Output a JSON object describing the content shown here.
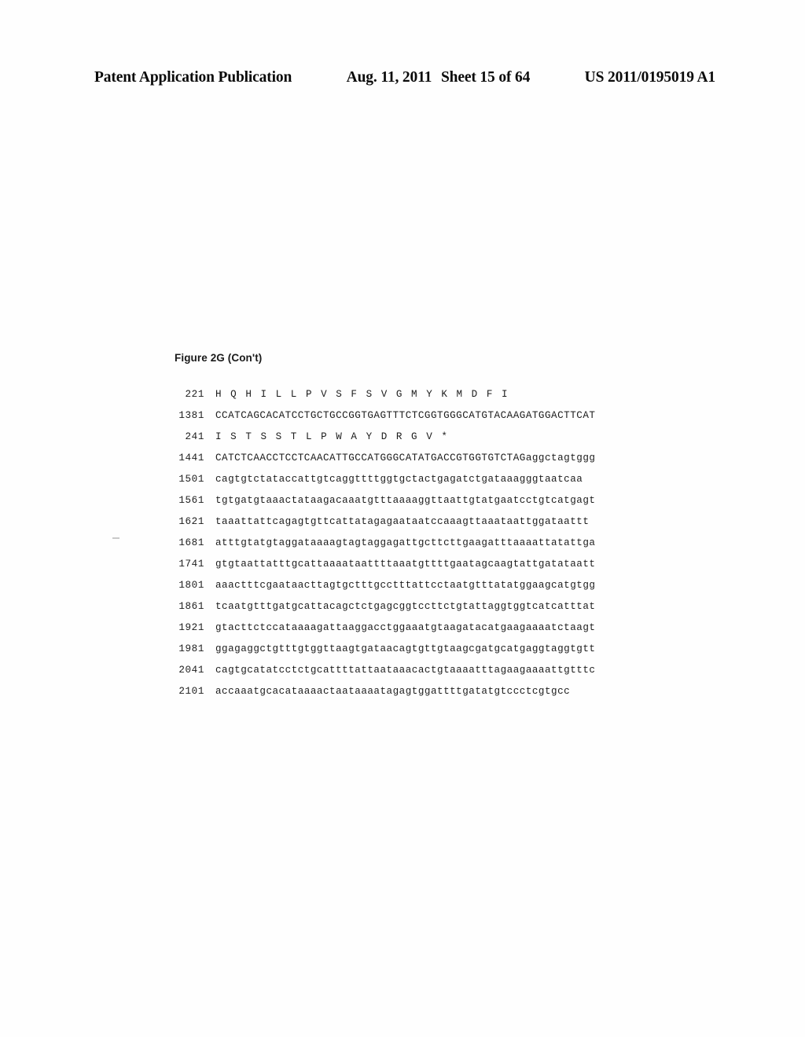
{
  "header": {
    "left": "Patent Application Publication",
    "date": "Aug. 11, 2011",
    "sheet": "Sheet 15 of 64",
    "right": "US 2011/0195019 A1"
  },
  "figure": {
    "caption": "Figure 2G (Con't)"
  },
  "sequence": {
    "rows": [
      {
        "index": "221",
        "kind": "protein",
        "text": "HQHILLPVSFSVGMYKMDFI"
      },
      {
        "index": "1381",
        "kind": "nucleotide",
        "text": "CCATCAGCACATCCTGCTGCCGGTGAGTTTCTCGGTGGGCATGTACAAGATGGACTTCAT"
      },
      {
        "index": "241",
        "kind": "protein",
        "text": "ISTSSTLPWAYDRGV*"
      },
      {
        "index": "1441",
        "kind": "nucleotide",
        "text": "CATCTCAACCTCCTCAACATTGCCATGGGCATATGACCGTGGTGTCTAGaggctagtggg"
      },
      {
        "index": "1501",
        "kind": "nucleotide",
        "text": "cagtgtctataccattgtcaggttttggtgctactgagatctgataaagggtaatcaa"
      },
      {
        "index": "1561",
        "kind": "nucleotide",
        "text": "tgtgatgtaaactataagacaaatgtttaaaaggttaattgtatgaatcctgtcatgagt"
      },
      {
        "index": "1621",
        "kind": "nucleotide",
        "text": "taaattattcagagtgttcattatagagaataatccaaagttaaataattggataattt"
      },
      {
        "index": "1681",
        "kind": "nucleotide",
        "text": "atttgtatgtaggataaaagtagtaggagattgcttcttgaagatttaaaattatattga"
      },
      {
        "index": "1741",
        "kind": "nucleotide",
        "text": "gtgtaattatttgcattaaaataattttaaatgttttgaatagcaagtattgatataatt"
      },
      {
        "index": "1801",
        "kind": "nucleotide",
        "text": "aaactttcgaataacttagtgctttgcctttattcctaatgtttatatggaagcatgtgg"
      },
      {
        "index": "1861",
        "kind": "nucleotide",
        "text": "tcaatgtttgatgcattacagctctgagcggtccttctgtattaggtggtcatcatttat"
      },
      {
        "index": "1921",
        "kind": "nucleotide",
        "text": "gtacttctccataaaagattaaggacctggaaatgtaagatacatgaagaaaatctaagt"
      },
      {
        "index": "1981",
        "kind": "nucleotide",
        "text": "ggagaggctgtttgtggttaagtgataacagtgttgtaagcgatgcatgaggtaggtgtt"
      },
      {
        "index": "2041",
        "kind": "nucleotide",
        "text": "cagtgcatatcctctgcattttattaataaacactgtaaaatttagaagaaaattgtttc"
      },
      {
        "index": "2101",
        "kind": "nucleotide",
        "text": "accaaatgcacataaaactaataaaatagagtggattttgatatgtccctcgtgcc"
      }
    ]
  }
}
